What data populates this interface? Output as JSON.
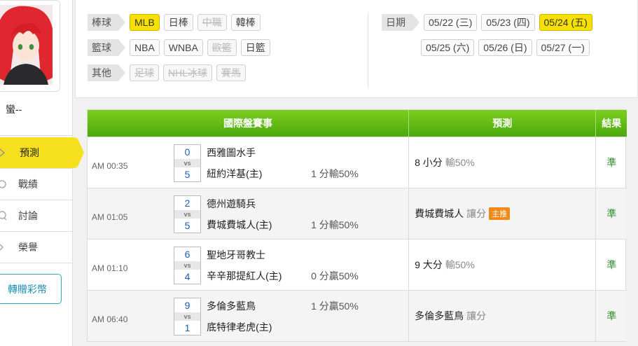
{
  "sidebar": {
    "username": "蠻--",
    "menu": [
      {
        "label": "預測",
        "icon": "prediction-icon",
        "active": true
      },
      {
        "label": "戰績",
        "icon": "record-icon",
        "active": false
      },
      {
        "label": "討論",
        "icon": "discussion-icon",
        "active": false
      },
      {
        "label": "榮譽",
        "icon": "honor-icon",
        "active": false
      }
    ],
    "gift_label": "轉贈彩幣"
  },
  "filters": {
    "baseball": {
      "tag": "棒球",
      "options": [
        "MLB",
        "日棒",
        "中職",
        "韓棒"
      ]
    },
    "basketball": {
      "tag": "籃球",
      "options": [
        "NBA",
        "WNBA",
        "歐籃",
        "日籃"
      ]
    },
    "other": {
      "tag": "其他",
      "options": [
        "足球",
        "NHL冰球",
        "賽馬"
      ]
    },
    "date_tag": "日期",
    "dates": [
      "05/22 (三)",
      "05/23 (四)",
      "05/24 (五)",
      "05/25 (六)",
      "05/26 (日)",
      "05/27 (一)"
    ]
  },
  "table": {
    "headers": {
      "match": "國際盤賽事",
      "prediction": "預測",
      "result": "結果"
    },
    "vs": "vs",
    "rows": [
      {
        "time": "AM 00:35",
        "score1": "0",
        "score2": "5",
        "team1": "西雅圖水手",
        "team2": "紐約洋基(主)",
        "spread1": "",
        "spread2": "1 分輸50%",
        "pred_main": "8 小分",
        "pred_sub": "輸50%",
        "badge": "",
        "result": "準"
      },
      {
        "time": "AM 01:05",
        "score1": "2",
        "score2": "5",
        "team1": "德州遊騎兵",
        "team2": "費城費城人(主)",
        "spread1": "",
        "spread2": "1 分輸50%",
        "pred_main": "費城費城人",
        "pred_sub": "讓分",
        "badge": "主推",
        "result": "準"
      },
      {
        "time": "AM 01:10",
        "score1": "6",
        "score2": "4",
        "team1": "聖地牙哥教士",
        "team2": "辛辛那提紅人(主)",
        "spread1": "",
        "spread2": "0 分贏50%",
        "pred_main": "9 大分",
        "pred_sub": "輸50%",
        "badge": "",
        "result": "準"
      },
      {
        "time": "AM 06:40",
        "score1": "9",
        "score2": "1",
        "team1": "多倫多藍鳥",
        "team2": "底特律老虎(主)",
        "spread1": "1 分贏50%",
        "spread2": "",
        "pred_main": "多倫多藍鳥",
        "pred_sub": "讓分",
        "badge": "",
        "result": "準"
      }
    ]
  }
}
